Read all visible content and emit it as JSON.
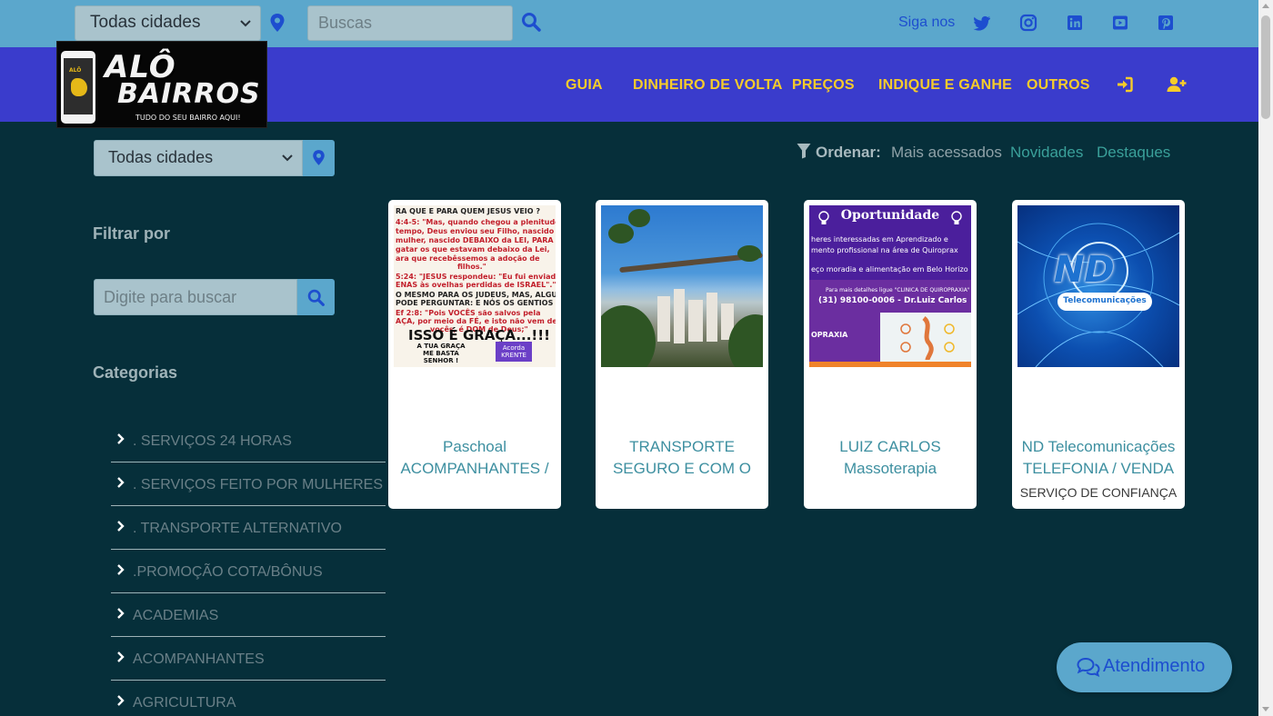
{
  "topbar": {
    "city_select_value": "Todas cidades",
    "search_placeholder": "Buscas",
    "follow_label": "Siga nos",
    "socials": [
      "twitter-icon",
      "instagram-icon",
      "linkedin-icon",
      "youtube-icon",
      "pinterest-icon"
    ]
  },
  "brand": {
    "line1": "ALÔ",
    "line2": "BAIRROS",
    "tagline": "TUDO DO SEU BAIRRO AQUI!"
  },
  "nav": {
    "items": [
      "GUIA",
      "DINHEIRO DE VOLTA",
      "PREÇOS",
      "INDIQUE E GANHE",
      "OUTROS"
    ],
    "icons": [
      "login-icon",
      "user-plus-icon"
    ]
  },
  "sidebar": {
    "city_select_value": "Todas cidades",
    "filter_heading": "Filtrar por",
    "search_placeholder": "Digite para buscar",
    "categories_heading": "Categorias",
    "categories": [
      ". SERVIÇOS 24 HORAS",
      ". SERVIÇOS FEITO POR MULHERES",
      ". TRANSPORTE ALTERNATIVO",
      ".PROMOÇÃO COTA/BÔNUS",
      "ACADEMIAS",
      "ACOMPANHANTES",
      "AGRICULTURA"
    ]
  },
  "sort": {
    "label": "Ordenar:",
    "options": [
      "Mais acessados",
      "Novidades",
      "Destaques"
    ]
  },
  "cards": [
    {
      "title_line1": "Paschoal",
      "title_line2": "ACOMPANHANTES /",
      "subtitle": "",
      "image": {
        "banner": "RA QUE E PARA QUEM JESUS VEIO ?",
        "lines": [
          "4:4-5: \"Mas, quando chegou a plenitude",
          " tempo, Deus enviou seu Filho, nascido",
          "mulher, nascido DEBAIXO da LEI, PARA",
          "gatar os que estavam debaixo da Lei,",
          "ara que recebêssemos a adoção de",
          "filhos.\"",
          "5:24: \"JESUS respondeu: \"Eu fui enviado",
          "ENAS às ovelhas perdidas de ISRAEL\".\"",
          "O MESMO PARA OS JUDEUS, MAS, ALGUÉM",
          "PODE PERGUNTAR: E NÓS OS GENTIOS ?",
          "Ef 2:8: \"Pois VOCÊS são salvos pela",
          "AÇA, por meio da FÉ, e isto não vem de",
          "vocês, é DOM de Deus;\""
        ],
        "headline": "ISSO É GRAÇA...!!!",
        "small": "A TUA GRAÇA ME BASTA SENHOR !",
        "tag": "Acorda KRENTE"
      }
    },
    {
      "title_line1": "TRANSPORTE",
      "title_line2": "SEGURO E COM O",
      "subtitle": ""
    },
    {
      "title_line1": "LUIZ CARLOS",
      "title_line2": "Massoterapia",
      "subtitle": "",
      "image": {
        "heading": "Oportunidade",
        "lines": [
          "heres interessadas em Aprendizado e",
          "mento profissional na área de Quiroprax",
          "eço moradia e alimentação em Belo Horizo"
        ],
        "band_lines": [
          "Para mais detalhes ligue \"CLINICA DE QUIROPRAXIA\"",
          "(31) 98100-0006 - Dr.Luiz Carlos"
        ],
        "brand": "OPRAXIA"
      }
    },
    {
      "title_line1": "ND Telecomunicações",
      "title_line2": "TELEFONIA / VENDA",
      "subtitle": "SERVIÇO DE CONFIANÇA",
      "image": {
        "logo": "ND",
        "pill": "Telecomunicações"
      }
    }
  ],
  "chat": {
    "label": "Atendimento"
  },
  "colors": {
    "topbar": "#5ba7cc",
    "navbar": "#3a3ccc",
    "nav_link": "#f6cc2a",
    "background": "#062f3a",
    "accent_link": "#3d8fa0"
  }
}
